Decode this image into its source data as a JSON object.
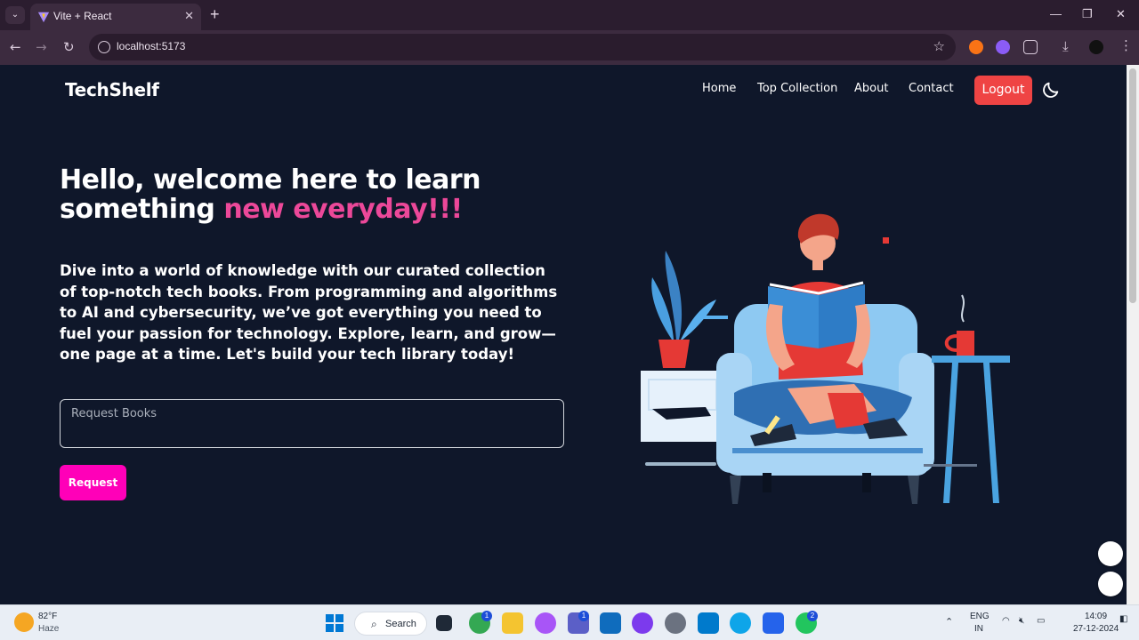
{
  "browser": {
    "tab_title": "Vite + React",
    "tab_close": "✕",
    "new_tab": "+",
    "url": "localhost:5173",
    "window_controls": {
      "minimize": "—",
      "restore": "❐",
      "close": "✕"
    }
  },
  "navbar": {
    "brand": "TechShelf",
    "links": [
      "Home",
      "Top Collection",
      "About",
      "Contact"
    ],
    "logout_label": "Logout",
    "theme_toggle_icon": "moon-icon"
  },
  "hero": {
    "title_line1": "Hello, welcome here to learn",
    "title_line2_prefix": "something",
    "title_line2_accent": "new everyday!!!",
    "description": "Dive into a world of knowledge with our curated collection of top-notch tech books. From programming and algorithms to AI and cybersecurity, we’ve got everything you need to fuel your passion for technology. Explore, learn, and grow—one page at a time. Let's build your tech library today!",
    "input_placeholder": "Request Books",
    "button_label": "Request"
  },
  "colors": {
    "background": "#0f172a",
    "accent_pink": "#ec4899",
    "logout_red": "#ef4444",
    "request_button": "#ff00b8"
  },
  "taskbar": {
    "weather_temp": "82°F",
    "weather_desc": "Haze",
    "search_label": "Search",
    "chrome_badge": "1",
    "teams_badge": "1",
    "whatsapp_badge": "2",
    "lang_line1": "ENG",
    "lang_line2": "IN",
    "time": "14:09",
    "date": "27-12-2024"
  }
}
